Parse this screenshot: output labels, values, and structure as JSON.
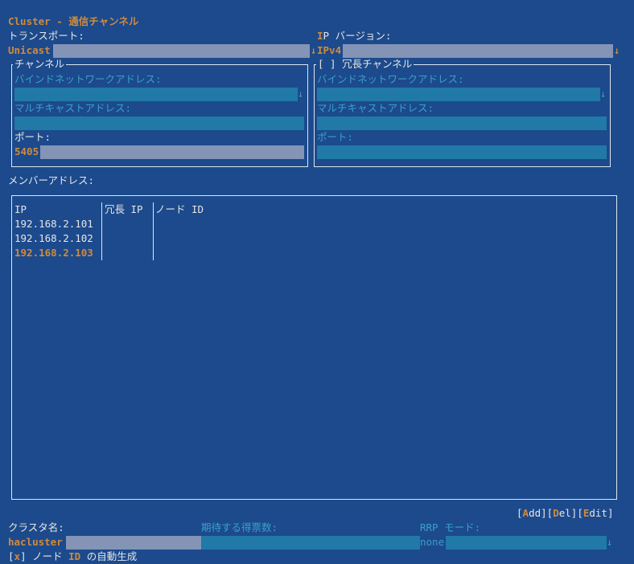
{
  "title": "Cluster - 通信チャンネル",
  "transport": {
    "label": "トランスポート:",
    "value": "Unicast"
  },
  "ip_version": {
    "label_hotkey": "I",
    "label_rest": "P バージョン:",
    "value": "IPv4"
  },
  "channel": {
    "title": "チャンネル",
    "bind_label": "バインドネットワークアドレス:",
    "mcast_label": "マルチキャストアドレス:",
    "port_label": "ポート:",
    "port_value": "5405"
  },
  "redundant": {
    "checkbox": "[ ]",
    "title": "冗長チャンネル",
    "bind_label": "バインドネットワークアドレス:",
    "mcast_label": "マルチキャストアドレス:",
    "port_label": "ポート:"
  },
  "members": {
    "label": "メンバーアドレス:",
    "columns": [
      "IP",
      "冗長 IP",
      "ノード ID"
    ],
    "rows": [
      "192.168.2.101",
      "192.168.2.102",
      "192.168.2.103"
    ]
  },
  "buttons": {
    "add_hotkey": "A",
    "add_rest": "dd",
    "del_hotkey": "D",
    "del_rest": "el",
    "edit_hotkey": "E",
    "edit_rest": "dit"
  },
  "cluster_name": {
    "label": "クラスタ名:",
    "value": "hacluster"
  },
  "expected_votes": {
    "label": "期待する得票数:"
  },
  "rrp_mode": {
    "label": "RRP モード:",
    "value": "none"
  },
  "auto_node_id": {
    "checkbox_mark": "x",
    "label_a": "ノード ",
    "label_hotkey": "ID",
    "label_b": " の自動生成"
  },
  "colors": {
    "background": "#1c4a8c",
    "accent_orange": "#d08a3c",
    "inactive_cyan": "#3aa0c8",
    "field_active": "#8494b6",
    "field_inactive": "#2179a7"
  }
}
